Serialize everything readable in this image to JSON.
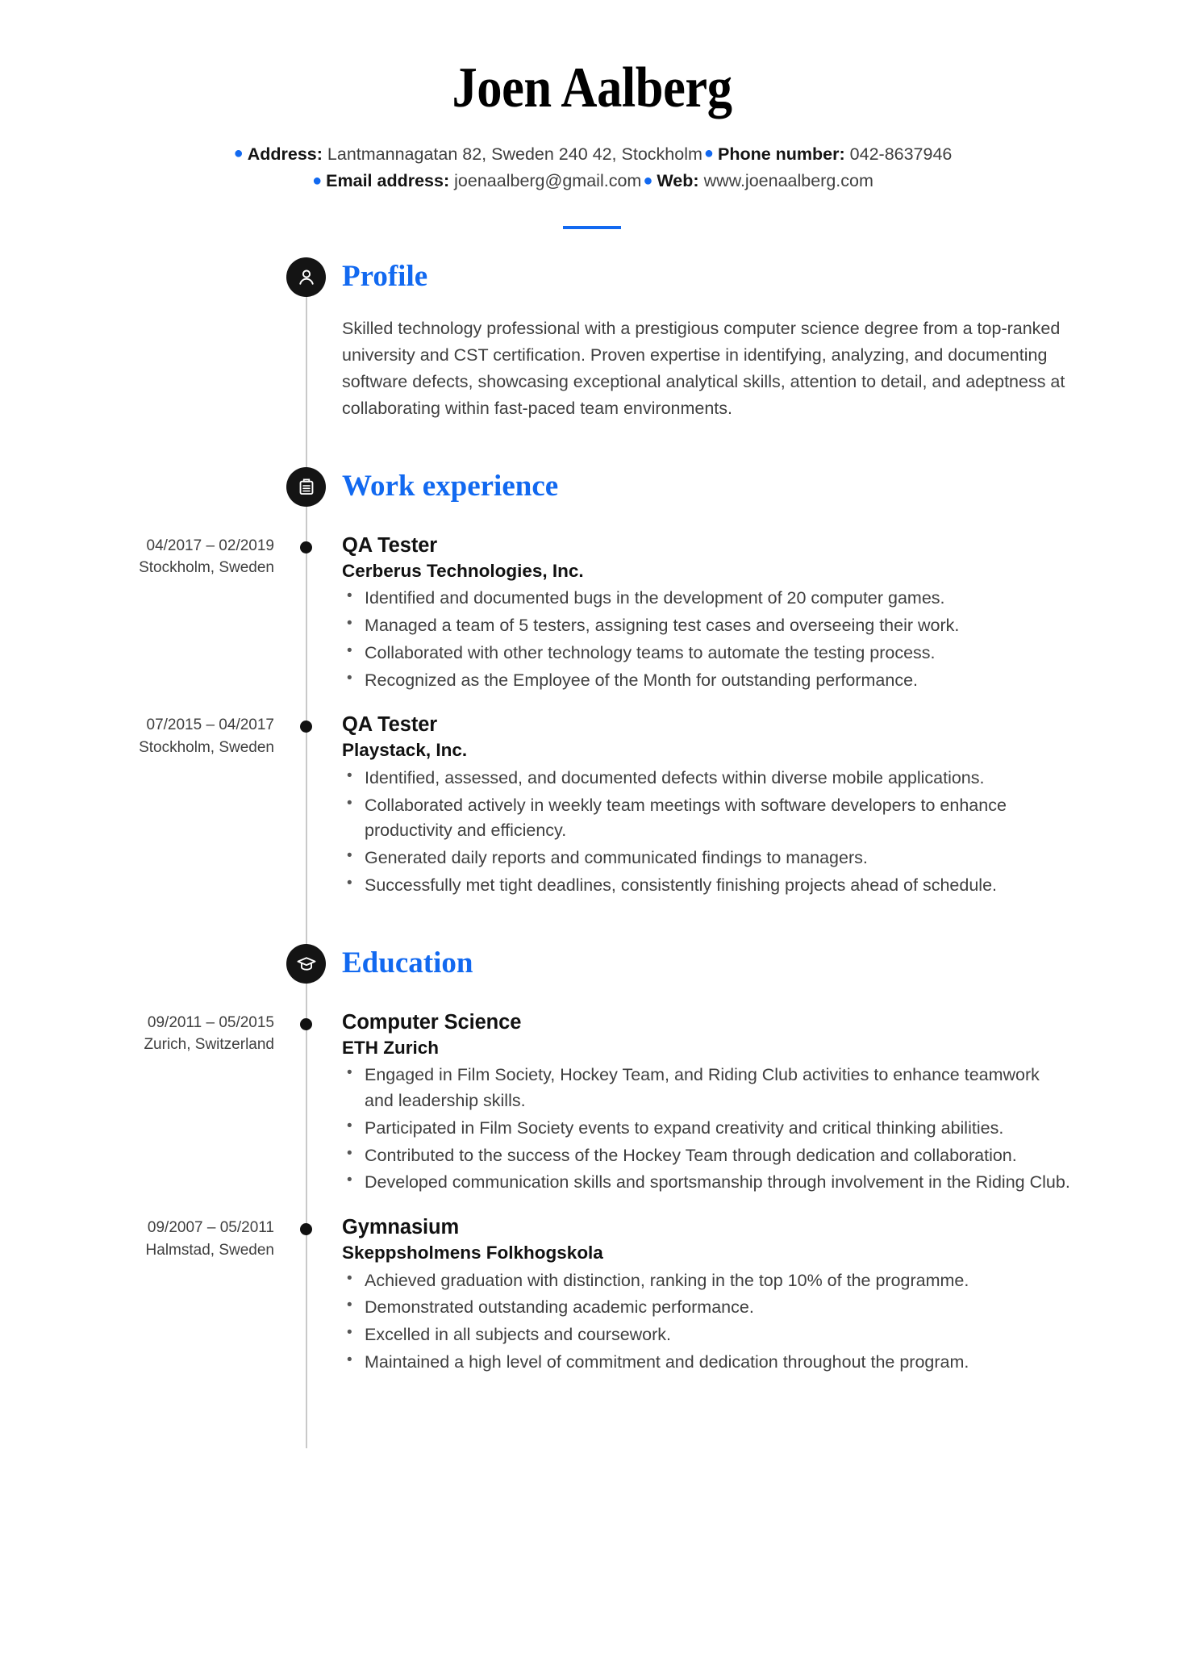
{
  "header": {
    "full_name": "Joen Aalberg",
    "accent_color": "#1269f0",
    "contact": {
      "address_label": "Address:",
      "address_value": "Lantmannagatan 82, Sweden 240 42, Stockholm",
      "phone_label": "Phone number:",
      "phone_value": "042-8637946",
      "email_label": "Email address:",
      "email_value": "joenaalberg@gmail.com",
      "web_label": "Web:",
      "web_value": "www.joenaalberg.com"
    }
  },
  "sections": {
    "profile": {
      "title": "Profile",
      "icon": "person-icon",
      "text": "Skilled technology professional with a prestigious computer science degree from a top-ranked university and CST certification. Proven expertise in identifying, analyzing, and documenting software defects, showcasing exceptional analytical skills, attention to detail, and adeptness at collaborating within fast-paced team environments."
    },
    "work": {
      "title": "Work experience",
      "icon": "briefcase-icon",
      "entries": [
        {
          "dates": "04/2017 – 02/2019",
          "location": "Stockholm, Sweden",
          "title": "QA Tester",
          "organization": "Cerberus Technologies, Inc.",
          "bullets": [
            "Identified and documented bugs in the development of 20 computer games.",
            "Managed a team of 5 testers, assigning test cases and overseeing their work.",
            "Collaborated with other technology teams to automate the testing process.",
            "Recognized as the Employee of the Month for outstanding performance."
          ]
        },
        {
          "dates": "07/2015 – 04/2017",
          "location": "Stockholm, Sweden",
          "title": "QA Tester",
          "organization": "Playstack, Inc.",
          "bullets": [
            "Identified, assessed, and documented defects within diverse mobile applications.",
            "Collaborated actively in weekly team meetings with software developers to enhance productivity and efficiency.",
            "Generated daily reports and communicated findings to managers.",
            "Successfully met tight deadlines, consistently finishing projects ahead of schedule."
          ]
        }
      ]
    },
    "education": {
      "title": "Education",
      "icon": "graduation-cap-icon",
      "entries": [
        {
          "dates": "09/2011 – 05/2015",
          "location": "Zurich, Switzerland",
          "title": "Computer Science",
          "organization": "ETH Zurich",
          "bullets": [
            "Engaged in Film Society, Hockey Team, and Riding Club activities to enhance teamwork and leadership skills.",
            "Participated in Film Society events to expand creativity and critical thinking abilities.",
            "Contributed to the success of the Hockey Team through dedication and collaboration.",
            "Developed communication skills and sportsmanship through involvement in the Riding Club."
          ]
        },
        {
          "dates": "09/2007 – 05/2011",
          "location": "Halmstad, Sweden",
          "title": "Gymnasium",
          "organization": "Skeppsholmens Folkhogskola",
          "bullets": [
            "Achieved graduation with distinction, ranking in the top 10% of the programme.",
            "Demonstrated outstanding academic performance.",
            "Excelled in all subjects and coursework.",
            "Maintained a high level of commitment and dedication throughout the program."
          ]
        }
      ]
    }
  }
}
